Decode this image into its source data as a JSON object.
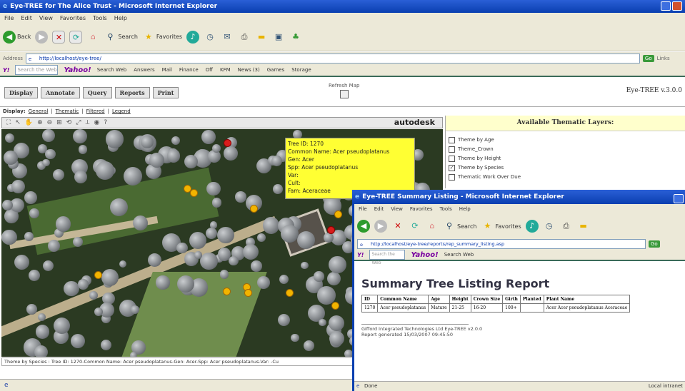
{
  "main_window": {
    "title": "Eye-TREE for The Alice Trust - Microsoft Internet Explorer",
    "menu": [
      "File",
      "Edit",
      "View",
      "Favorites",
      "Tools",
      "Help"
    ],
    "toolbar": {
      "back": "Back",
      "search": "Search",
      "favorites": "Favorites"
    },
    "address_label": "Address",
    "address": "http://localhost/eye-tree/",
    "go": "Go",
    "links": "Links",
    "yahoo_bar": {
      "search_placeholder": "Search the Web",
      "yahoo": "Yahoo!",
      "search_web": "Search Web",
      "items": [
        "Search Web",
        "Answers",
        "Mail",
        "Finance",
        "Off",
        "KFM",
        "News (3)",
        "Games",
        "Storage"
      ]
    },
    "status": ""
  },
  "app": {
    "tabs": [
      "Display",
      "Annotate",
      "Query",
      "Reports",
      "Print"
    ],
    "refresh_map": "Refresh Map",
    "version": "Eye-TREE v.3.0.0",
    "display_label": "Display:",
    "display_links": [
      "General",
      "Thematic",
      "Filtered",
      "Legend"
    ],
    "brand": "autodesk",
    "tooltip": [
      "Tree ID: 1270",
      "Common Name: Acer pseudoplatanus",
      "Gen: Acer",
      "Spp: Acer pseudoplatanus",
      "Var:",
      "Cult:",
      "Fam: Aceraceae"
    ],
    "statusbar": "Theme by Species : Tree ID: 1270-Common Name: Acer pseudoplatanus-Gen: Acer-Spp: Acer pseudoplatanus-Var: -Cu",
    "layers_title": "Available Thematic Layers:",
    "layers": [
      {
        "label": "Theme by Age",
        "checked": false
      },
      {
        "label": "Theme_Crown",
        "checked": false
      },
      {
        "label": "Theme by Height",
        "checked": false
      },
      {
        "label": "Theme by Species",
        "checked": true
      },
      {
        "label": "Thematic Work Over Due",
        "checked": false
      }
    ]
  },
  "popup": {
    "title": "Eye-TREE Summary Listing - Microsoft Internet Explorer",
    "menu": [
      "File",
      "Edit",
      "View",
      "Favorites",
      "Tools",
      "Help"
    ],
    "address": "http://localhost/eye-tree/reports/rep_summary_listing.asp",
    "heading": "Summary Tree Listing Report",
    "columns": [
      "ID",
      "Common Name",
      "Age",
      "Height",
      "Crown Size",
      "Girth",
      "Planted",
      "Plant Name"
    ],
    "rows": [
      [
        "1270",
        "Acer pseudoplatanus",
        "Mature",
        "21-25",
        "16-20",
        "100+",
        "",
        "Acer Acer pseudoplatanus Aceraceae"
      ]
    ],
    "footer1": "Gifford Integrated Technologies Ltd Eye-TREE v2.0.0",
    "footer2": "Report generated 15/03/2007 09:45:50",
    "status": "Done",
    "zone": "Local intranet"
  }
}
